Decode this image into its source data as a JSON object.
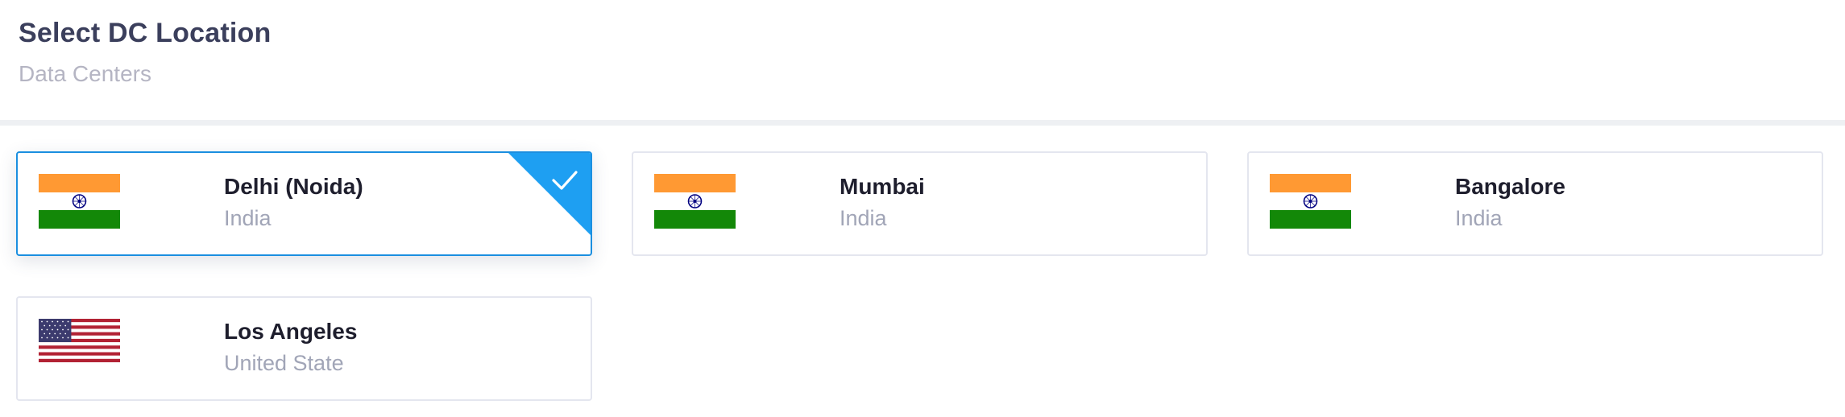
{
  "header": {
    "title": "Select DC Location",
    "subtitle": "Data Centers"
  },
  "locations": [
    {
      "city": "Delhi (Noida)",
      "country": "India",
      "flag_icon": "india-flag-icon",
      "selected": true
    },
    {
      "city": "Mumbai",
      "country": "India",
      "flag_icon": "india-flag-icon",
      "selected": false
    },
    {
      "city": "Bangalore",
      "country": "India",
      "flag_icon": "india-flag-icon",
      "selected": false
    },
    {
      "city": "Los Angeles",
      "country": "United State",
      "flag_icon": "usa-flag-icon",
      "selected": false
    }
  ],
  "colors": {
    "accent": "#1b8fe0",
    "selected_badge": "#1e9ff2",
    "title": "#3b3f5c",
    "muted": "#b5b5c3",
    "saffron": "#ff9933",
    "india_green": "#138808"
  }
}
